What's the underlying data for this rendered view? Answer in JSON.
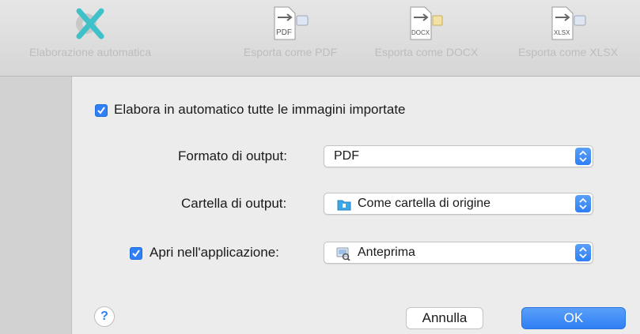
{
  "toolbar": {
    "items": [
      {
        "label": "Elaborazione automatica",
        "icon": "auto-process-icon"
      },
      {
        "label": "Esporta come PDF",
        "icon": "export-pdf-icon",
        "badge": "PDF"
      },
      {
        "label": "Esporta come DOCX",
        "icon": "export-docx-icon",
        "badge": "DOCX"
      },
      {
        "label": "Esporta come XLSX",
        "icon": "export-xlsx-icon",
        "badge": "XLSX"
      }
    ]
  },
  "dialog": {
    "auto_process": {
      "label": "Elabora in automatico tutte le immagini importate",
      "checked": true
    },
    "output_format": {
      "label": "Formato di output:",
      "value": "PDF"
    },
    "output_folder": {
      "label": "Cartella di output:",
      "value": "Come cartella di origine",
      "icon": "folder-icon"
    },
    "open_in_app": {
      "label": "Apri nell'applicazione:",
      "checked": true,
      "value": "Anteprima",
      "icon": "preview-app-icon"
    },
    "help_label": "?",
    "cancel_label": "Annulla",
    "ok_label": "OK"
  },
  "colors": {
    "accent": "#2f7ff5",
    "teal": "#3fc1c9",
    "disabled_text": "#bdbdbd"
  }
}
